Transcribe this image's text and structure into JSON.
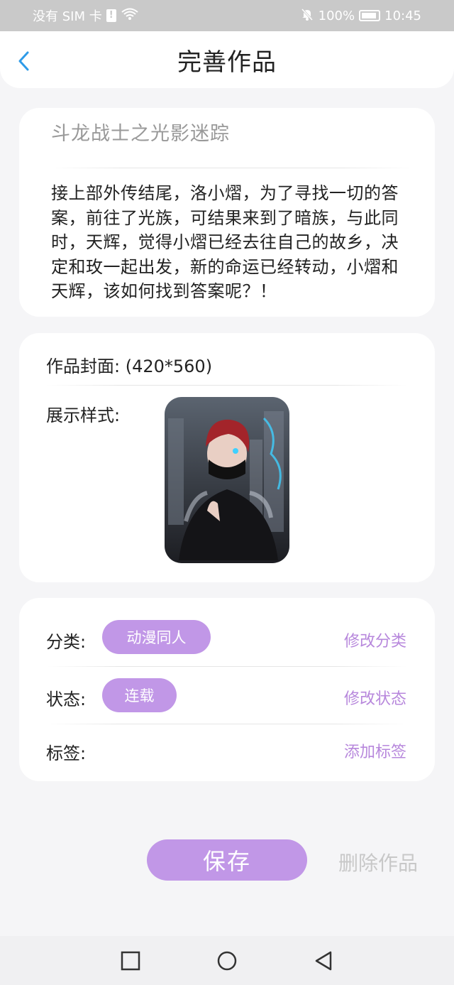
{
  "status_bar": {
    "carrier": "没有 SIM 卡",
    "sim_alert": "!",
    "battery": "100%",
    "time": "10:45"
  },
  "header": {
    "title": "完善作品",
    "back_icon": "chevron-left-icon"
  },
  "work": {
    "title": "斗龙战士之光影迷踪",
    "description": "接上部外传结尾，洛小熠，为了寻找一切的答案，前往了光族，可结果来到了暗族，与此同时，天辉，觉得小熠已经去往自己的故乡，决定和玫一起出发，新的命运已经转动，小熠和天辉，该如何找到答案呢？！"
  },
  "cover": {
    "label": "作品封面: (420*560)",
    "style_label": "展示样式:"
  },
  "meta": {
    "category_label": "分类:",
    "category_value": "动漫同人",
    "category_action": "修改分类",
    "status_label": "状态:",
    "status_value": "连载",
    "status_action": "修改状态",
    "tags_label": "标签:",
    "tags_action": "添加标签"
  },
  "actions": {
    "save": "保存",
    "delete": "删除作品"
  },
  "colors": {
    "accent": "#c197e7",
    "accent_text": "#b787dc",
    "back_icon": "#2f9be8",
    "muted": "#c8c8c8"
  }
}
